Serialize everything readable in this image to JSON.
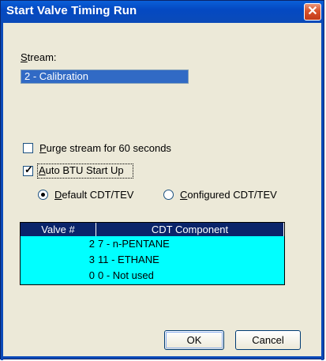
{
  "window": {
    "title": "Start Valve Timing Run",
    "close_glyph": "✕"
  },
  "stream": {
    "label_mnemonic": "S",
    "label_rest": "tream:",
    "value": "2 - Calibration"
  },
  "purge": {
    "mnemonic": "P",
    "label_rest": "urge stream for 60 seconds",
    "checked": false
  },
  "auto_btu": {
    "mnemonic": "A",
    "label_rest": "uto BTU Start Up",
    "checked": true,
    "check_glyph": "✓"
  },
  "mode": {
    "default_mnemonic": "D",
    "default_rest": "efault CDT/TEV",
    "configured_mnemonic": "C",
    "configured_rest": "onfigured CDT/TEV",
    "selected": "default"
  },
  "table": {
    "headers": [
      "Valve #",
      "CDT Component"
    ],
    "rows": [
      {
        "valve": "2",
        "component": "7 - n-PENTANE"
      },
      {
        "valve": "3",
        "component": "11 - ETHANE"
      },
      {
        "valve": "0",
        "component": "0 - Not used"
      }
    ],
    "colors": {
      "header_bg": "#0a246a",
      "row_bg": "#00ffff"
    }
  },
  "buttons": {
    "ok_label": "OK",
    "cancel_label": "Cancel"
  },
  "colors": {
    "titlebar": "#0449c2",
    "selection": "#316ac5",
    "dialog_bg": "#ece9d8"
  }
}
